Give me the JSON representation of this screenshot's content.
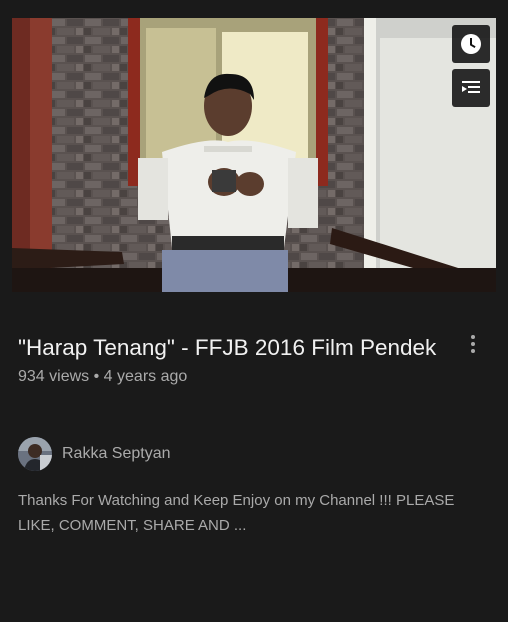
{
  "video": {
    "title": "\"Harap Tenang\" - FFJB 2016 Film Pendek",
    "views": "934 views",
    "separator": "•",
    "age": "4 years ago",
    "channel": "Rakka Septyan",
    "description": "Thanks For Watching and Keep Enjoy on my Channel !!! PLEASE LIKE, COMMENT, SHARE AND ..."
  },
  "icons": {
    "watch_later": "clock-icon",
    "add_to_queue": "playlist-add-icon",
    "more": "more-vert-icon"
  },
  "colors": {
    "background": "#1a1a1a",
    "title": "#f1f1f1",
    "secondary_text": "#aaaaaa"
  }
}
